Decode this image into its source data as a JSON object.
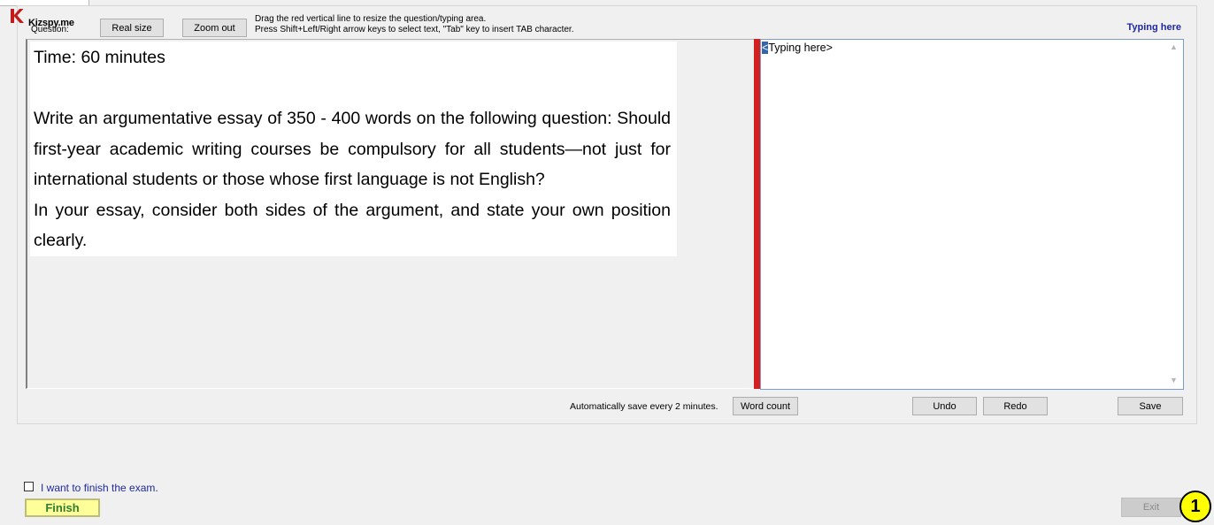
{
  "brand": {
    "logo_letter": "K",
    "name": "Kizspy.me"
  },
  "toolbar": {
    "question_label": "Question:",
    "real_size_label": "Real size",
    "zoom_out_label": "Zoom out",
    "help_line1": "Drag the red vertical line to resize the question/typing area.",
    "help_line2": "Press Shift+Left/Right arrow keys to select text, \"Tab\" key to insert TAB character.",
    "typing_header": "Typing here"
  },
  "question": {
    "time": "Time: 60 minutes",
    "paragraph1": "Write an argumentative essay of 350 - 400 words on the following question: Should first-year academic writing courses be compulsory for all students—not just for international students or those whose first language is not English?",
    "paragraph2": "In your essay, consider both sides of the argument, and state your own position clearly."
  },
  "typing": {
    "cursor_char": "<",
    "placeholder_rest": "Typing here>",
    "scroll_up_glyph": "▲",
    "scroll_down_glyph": "▼"
  },
  "bottom_bar": {
    "autosave_text": "Automatically save every 2 minutes.",
    "word_count_label": "Word count",
    "undo_label": "Undo",
    "redo_label": "Redo",
    "save_label": "Save"
  },
  "finish": {
    "checkbox_label": "I want to finish the exam.",
    "checked": false,
    "finish_label": "Finish",
    "exit_label": "Exit"
  },
  "badge": {
    "number": "1"
  },
  "colors": {
    "divider": "#d41f1f",
    "typing_header": "#1f2a9c",
    "finish_bg": "#ffff99",
    "badge_bg": "#ffff00"
  }
}
